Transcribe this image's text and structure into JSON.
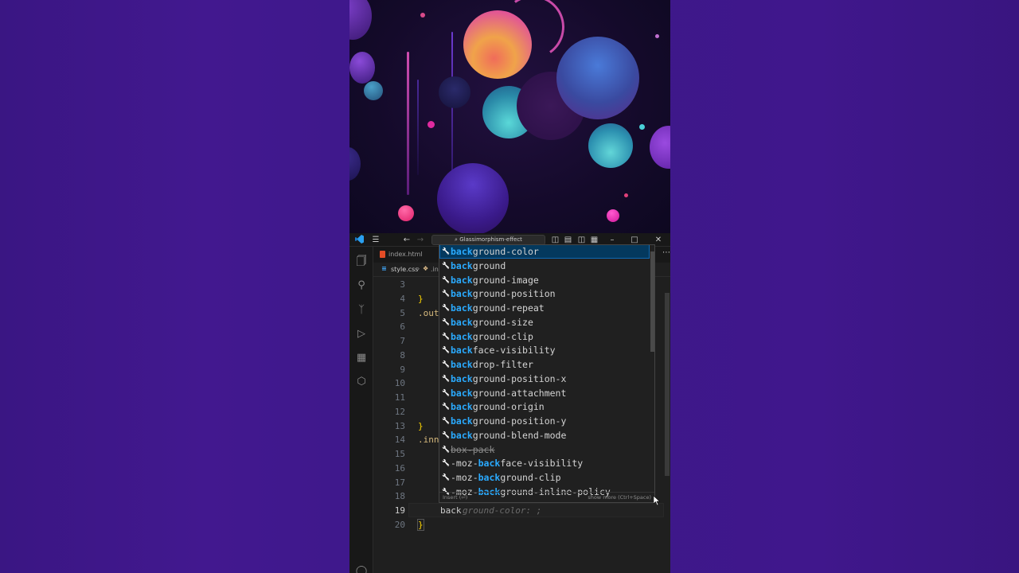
{
  "window": {
    "search_text": "Glassimorphism-effect"
  },
  "tabs": {
    "html_tab": "index.html",
    "css_tab": "style.css",
    "breadcrumb_fragment": ".in"
  },
  "editor": {
    "line_numbers": [
      "3",
      "4",
      "5",
      "6",
      "7",
      "8",
      "9",
      "10",
      "11",
      "12",
      "13",
      "14",
      "15",
      "16",
      "17",
      "18",
      "19",
      "20"
    ],
    "active_line": "19",
    "code": {
      "brace_close_4": "}",
      "selector_5": ".out",
      "brace_close_13": "}",
      "selector_14": ".inn",
      "typed_19": "back",
      "ghost_19": "ground-color: ;",
      "brace_close_20": "}"
    }
  },
  "suggest": {
    "match_prefix": "back",
    "items": [
      {
        "pre": "",
        "match": "back",
        "rest": "ground-color",
        "selected": true
      },
      {
        "pre": "",
        "match": "back",
        "rest": "ground"
      },
      {
        "pre": "",
        "match": "back",
        "rest": "ground-image"
      },
      {
        "pre": "",
        "match": "back",
        "rest": "ground-position"
      },
      {
        "pre": "",
        "match": "back",
        "rest": "ground-repeat"
      },
      {
        "pre": "",
        "match": "back",
        "rest": "ground-size"
      },
      {
        "pre": "",
        "match": "back",
        "rest": "ground-clip"
      },
      {
        "pre": "",
        "match": "back",
        "rest": "face-visibility"
      },
      {
        "pre": "",
        "match": "back",
        "rest": "drop-filter"
      },
      {
        "pre": "",
        "match": "back",
        "rest": "ground-position-x"
      },
      {
        "pre": "",
        "match": "back",
        "rest": "ground-attachment"
      },
      {
        "pre": "",
        "match": "back",
        "rest": "ground-origin"
      },
      {
        "pre": "",
        "match": "back",
        "rest": "ground-position-y"
      },
      {
        "pre": "",
        "match": "back",
        "rest": "ground-blend-mode"
      },
      {
        "pre": "",
        "match": "",
        "rest": "box-pack",
        "strike": true
      },
      {
        "pre": "-moz-",
        "match": "back",
        "rest": "face-visibility"
      },
      {
        "pre": "-moz-",
        "match": "back",
        "rest": "ground-clip"
      },
      {
        "pre": "-moz-",
        "match": "back",
        "rest": "ground-inline-policy"
      }
    ],
    "status_left": "Insert (⏎)",
    "status_right": "show more (Ctrl+Space)"
  },
  "colors": {
    "background": "#3b1888",
    "editor_bg": "#1f1f1f",
    "selection": "#04395e",
    "match_highlight": "#2aaaff"
  },
  "icons": [
    "vscode-logo-icon",
    "menu-icon",
    "back-arrow-icon",
    "forward-arrow-icon",
    "search-icon",
    "layout-icons",
    "minimize-icon",
    "maximize-icon",
    "close-icon",
    "explorer-icon",
    "search-sidebar-icon",
    "source-control-icon",
    "run-debug-icon",
    "extensions-icon",
    "remote-icon",
    "account-icon",
    "wrench-icon"
  ]
}
